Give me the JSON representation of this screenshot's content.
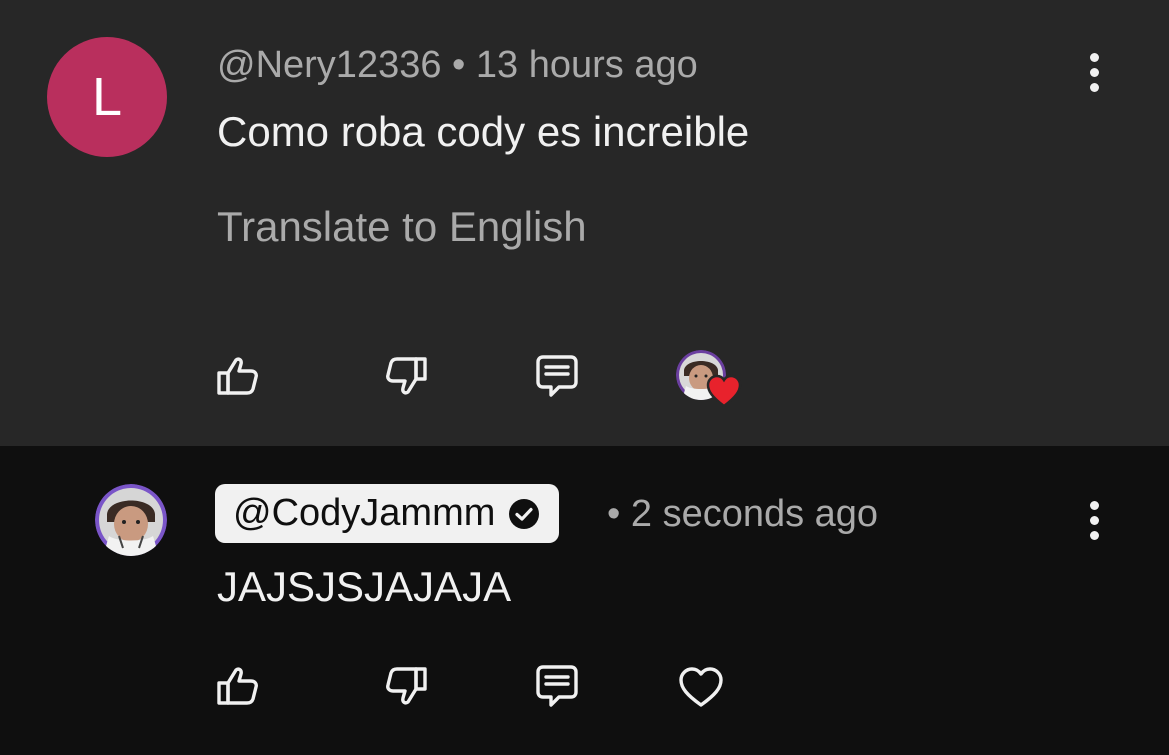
{
  "comments": [
    {
      "avatar_letter": "L",
      "author": "@Nery12336",
      "separator": "•",
      "time": "13 hours ago",
      "text": "Como roba cody es increible",
      "translate_label": "Translate to English",
      "hearted_by_creator": true
    },
    {
      "author": "@CodyJammm",
      "verified": true,
      "separator": "•",
      "time": "2 seconds ago",
      "text": "JAJSJSJAJAJA",
      "hearted_by_creator": false
    }
  ],
  "icons": {
    "like": "thumbs-up-icon",
    "dislike": "thumbs-down-icon",
    "reply": "reply-comment-icon",
    "heart": "heart-icon",
    "more": "more-vertical-icon",
    "verified": "verified-check-icon"
  },
  "colors": {
    "top_comment_bg": "#272727",
    "reply_bg": "#0f0f0f",
    "avatar_bg": "#b92f5d",
    "heart_red": "#e8222c",
    "meta_text": "#aaaaaa",
    "primary_text": "#f1f1f1"
  }
}
